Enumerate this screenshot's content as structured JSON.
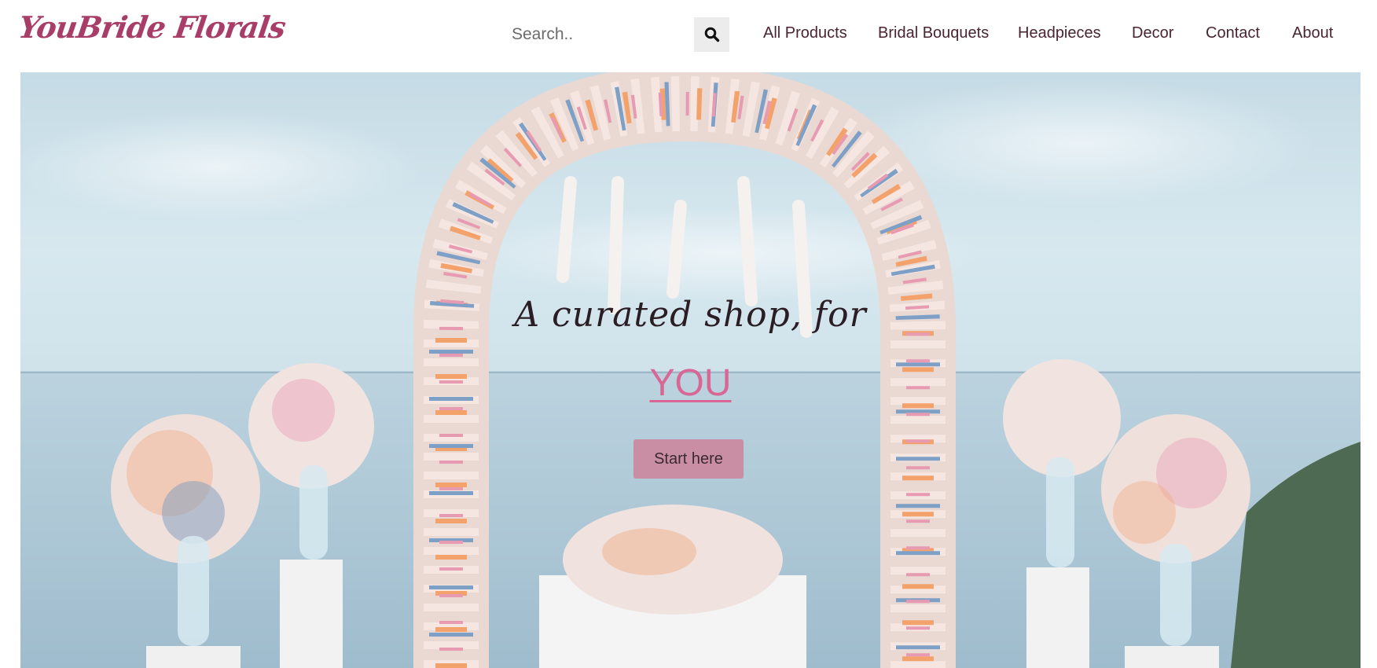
{
  "header": {
    "logo_text": "YouBride Florals",
    "search": {
      "placeholder": "Search..",
      "value": "",
      "button_icon": "search-icon"
    },
    "nav": [
      {
        "label": "All Products"
      },
      {
        "label": "Bridal Bouquets"
      },
      {
        "label": "Headpieces"
      },
      {
        "label": "Decor"
      },
      {
        "label": "Contact"
      },
      {
        "label": "About"
      }
    ]
  },
  "hero": {
    "subtitle": "A curated shop, for",
    "title": "YOU",
    "cta_label": "Start here"
  },
  "colors": {
    "logo": "#a83e68",
    "nav_text": "#4a2433",
    "accent_pink": "#d86795",
    "cta_background": "#c98ea3",
    "search_button_bg": "#ececec"
  }
}
